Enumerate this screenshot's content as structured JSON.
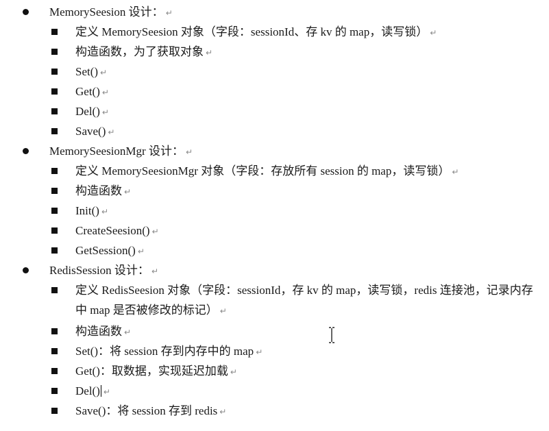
{
  "sections": [
    {
      "title": "MemorySeesion 设计：",
      "items": [
        "定义 MemorySeesion 对象（字段：sessionId、存 kv 的 map，读写锁）",
        "构造函数，为了获取对象",
        "Set()",
        "Get()",
        "Del()",
        "Save()"
      ]
    },
    {
      "title": "MemorySeesionMgr 设计：",
      "items": [
        "定义 MemorySeesionMgr 对象（字段：存放所有 session 的 map，读写锁）",
        "构造函数",
        "Init()",
        "CreateSeesion()",
        "GetSession()"
      ]
    },
    {
      "title": "RedisSession 设计：",
      "items": [
        "定义 RedisSeesion 对象（字段：sessionId，存 kv 的 map，读写锁，redis 连接池，记录内存中 map 是否被修改的标记）",
        "构造函数",
        "Set()：将 session 存到内存中的 map",
        "Get()：取数据，实现延迟加载",
        "Del()",
        "Save()：将 session 存到 redis"
      ]
    }
  ],
  "paragraph_mark": "↵"
}
